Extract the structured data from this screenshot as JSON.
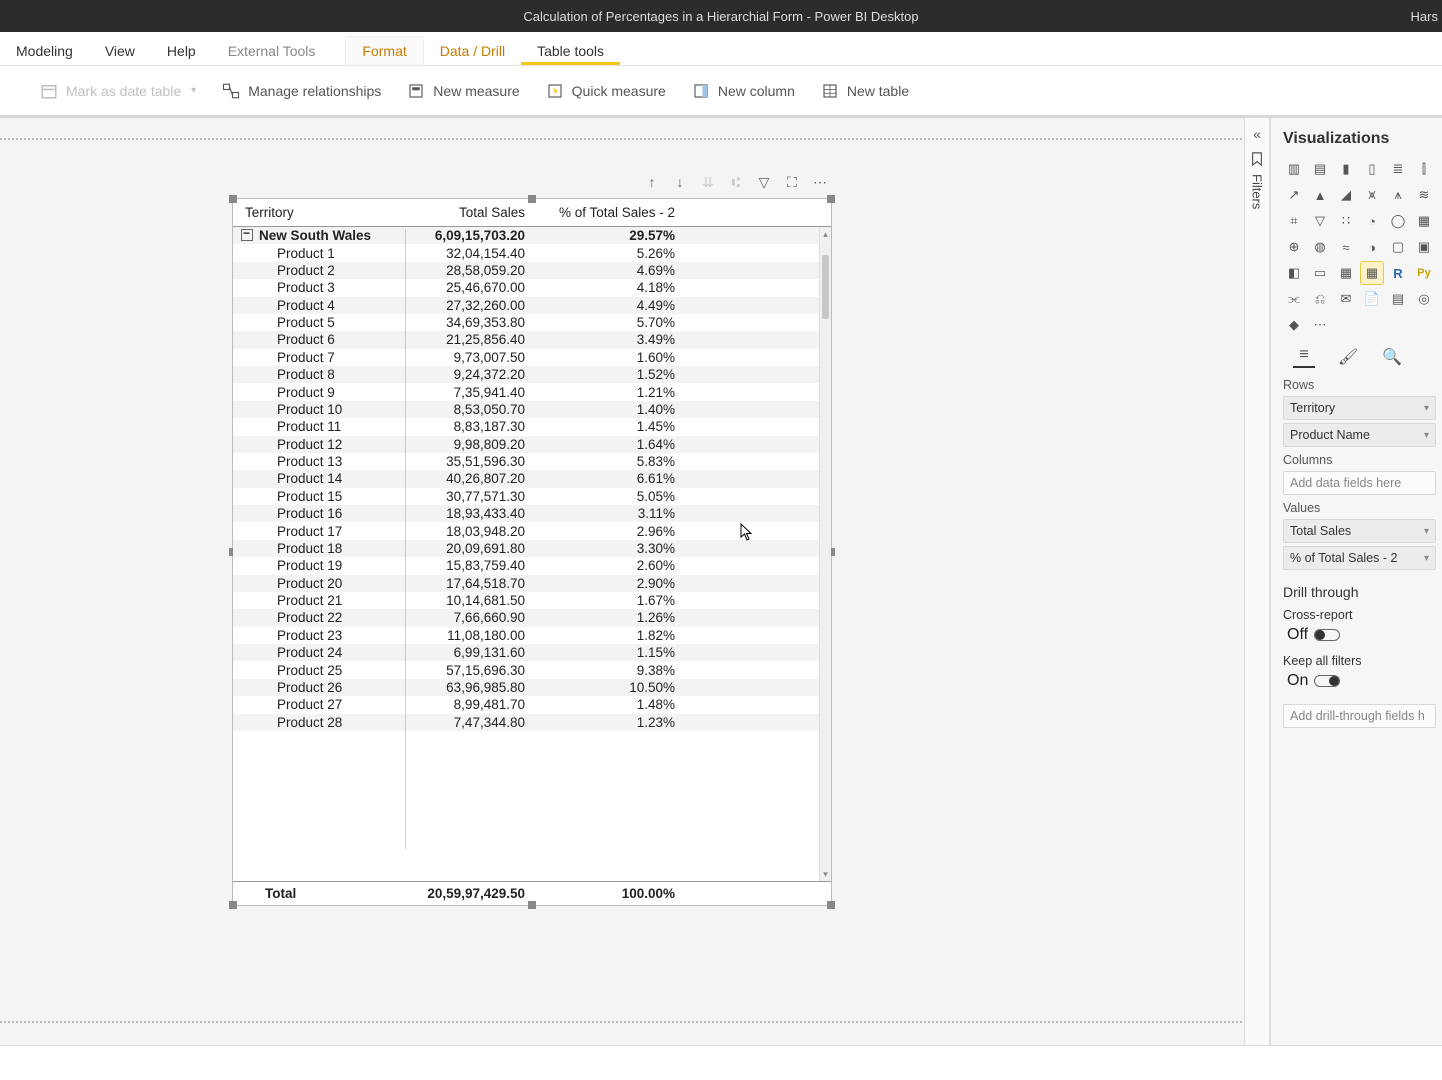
{
  "title": "Calculation of Percentages in a Hierarchial Form - Power BI Desktop",
  "title_right": "Hars",
  "menu": {
    "modeling": "Modeling",
    "view": "View",
    "help": "Help",
    "external_tools": "External Tools",
    "format": "Format",
    "data_drill": "Data / Drill",
    "table_tools": "Table tools"
  },
  "ribbon": {
    "mark_date": "Mark as date table",
    "relationships": "Manage relationships",
    "new_measure": "New measure",
    "quick_measure": "Quick measure",
    "new_column": "New column",
    "new_table": "New table"
  },
  "filters_label": "Filters",
  "viz": {
    "title": "Visualizations",
    "rows_label": "Rows",
    "rows": [
      "Territory",
      "Product Name"
    ],
    "columns_label": "Columns",
    "columns_placeholder": "Add data fields here",
    "values_label": "Values",
    "values": [
      "Total Sales",
      "% of Total Sales - 2"
    ],
    "drill_title": "Drill through",
    "cross_report_label": "Cross-report",
    "cross_report_state": "Off",
    "keep_filters_label": "Keep all filters",
    "keep_filters_state": "On",
    "drill_placeholder": "Add drill-through fields h"
  },
  "matrix": {
    "headers": {
      "c1": "Territory",
      "c2": "Total Sales",
      "c3": "% of Total Sales - 2"
    },
    "group": {
      "name": "New South Wales",
      "total": "6,09,15,703.20",
      "pct": "29.57%"
    },
    "rows": [
      {
        "name": "Product 1",
        "total": "32,04,154.40",
        "pct": "5.26%"
      },
      {
        "name": "Product 2",
        "total": "28,58,059.20",
        "pct": "4.69%"
      },
      {
        "name": "Product 3",
        "total": "25,46,670.00",
        "pct": "4.18%"
      },
      {
        "name": "Product 4",
        "total": "27,32,260.00",
        "pct": "4.49%"
      },
      {
        "name": "Product 5",
        "total": "34,69,353.80",
        "pct": "5.70%"
      },
      {
        "name": "Product 6",
        "total": "21,25,856.40",
        "pct": "3.49%"
      },
      {
        "name": "Product 7",
        "total": "9,73,007.50",
        "pct": "1.60%"
      },
      {
        "name": "Product 8",
        "total": "9,24,372.20",
        "pct": "1.52%"
      },
      {
        "name": "Product 9",
        "total": "7,35,941.40",
        "pct": "1.21%"
      },
      {
        "name": "Product 10",
        "total": "8,53,050.70",
        "pct": "1.40%"
      },
      {
        "name": "Product 11",
        "total": "8,83,187.30",
        "pct": "1.45%"
      },
      {
        "name": "Product 12",
        "total": "9,98,809.20",
        "pct": "1.64%"
      },
      {
        "name": "Product 13",
        "total": "35,51,596.30",
        "pct": "5.83%"
      },
      {
        "name": "Product 14",
        "total": "40,26,807.20",
        "pct": "6.61%"
      },
      {
        "name": "Product 15",
        "total": "30,77,571.30",
        "pct": "5.05%"
      },
      {
        "name": "Product 16",
        "total": "18,93,433.40",
        "pct": "3.11%"
      },
      {
        "name": "Product 17",
        "total": "18,03,948.20",
        "pct": "2.96%"
      },
      {
        "name": "Product 18",
        "total": "20,09,691.80",
        "pct": "3.30%"
      },
      {
        "name": "Product 19",
        "total": "15,83,759.40",
        "pct": "2.60%"
      },
      {
        "name": "Product 20",
        "total": "17,64,518.70",
        "pct": "2.90%"
      },
      {
        "name": "Product 21",
        "total": "10,14,681.50",
        "pct": "1.67%"
      },
      {
        "name": "Product 22",
        "total": "7,66,660.90",
        "pct": "1.26%"
      },
      {
        "name": "Product 23",
        "total": "11,08,180.00",
        "pct": "1.82%"
      },
      {
        "name": "Product 24",
        "total": "6,99,131.60",
        "pct": "1.15%"
      },
      {
        "name": "Product 25",
        "total": "57,15,696.30",
        "pct": "9.38%"
      },
      {
        "name": "Product 26",
        "total": "63,96,985.80",
        "pct": "10.50%"
      },
      {
        "name": "Product 27",
        "total": "8,99,481.70",
        "pct": "1.48%"
      },
      {
        "name": "Product 28",
        "total": "7,47,344.80",
        "pct": "1.23%"
      }
    ],
    "footer": {
      "label": "Total",
      "total": "20,59,97,429.50",
      "pct": "100.00%"
    }
  }
}
